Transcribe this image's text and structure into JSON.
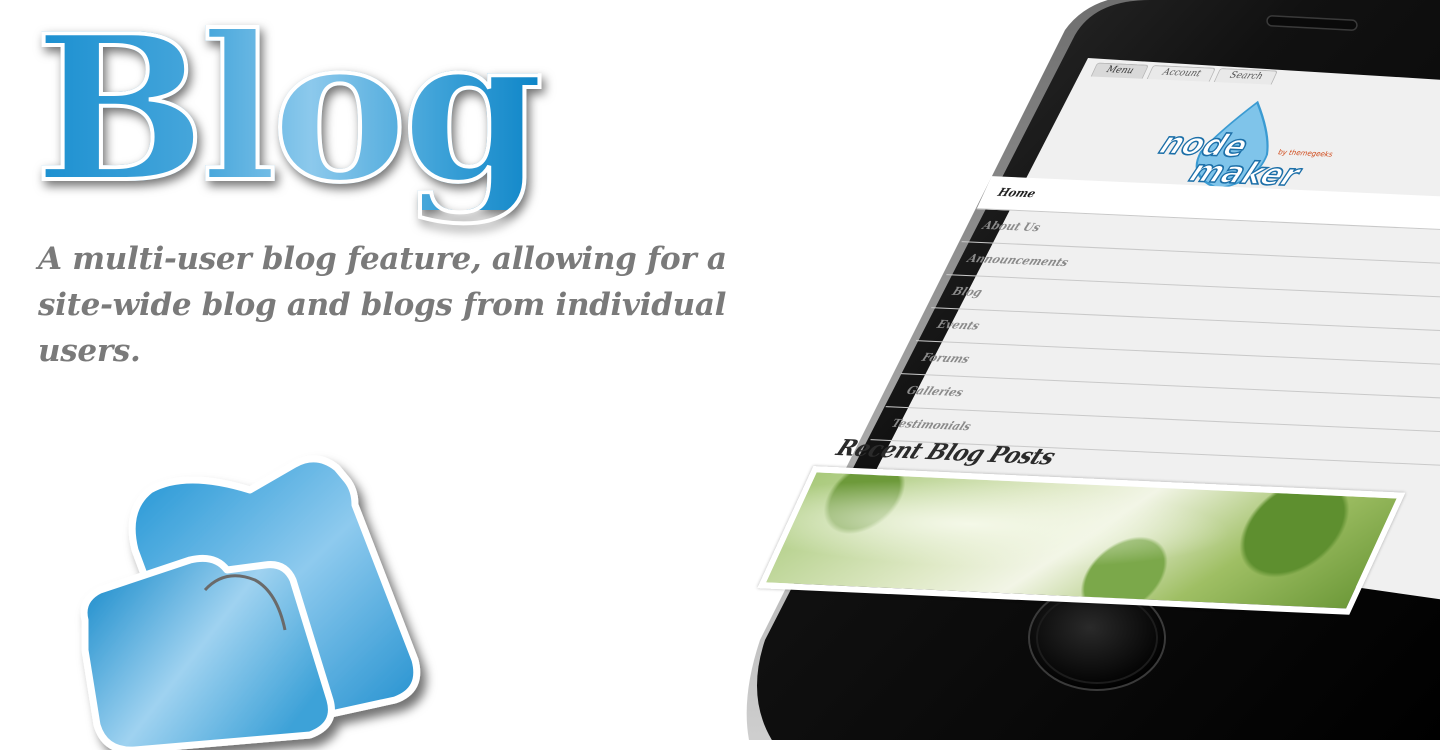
{
  "hero": {
    "title": "Blog",
    "description": "A multi-user blog feature, allowing for a site-wide blog and blogs from individual users."
  },
  "colors": {
    "brand_blue": "#1a8fd0",
    "brand_light_blue": "#8cc9ec",
    "text_gray": "#7a7a7a",
    "phone_black": "#111111"
  },
  "phone": {
    "tabs": [
      {
        "label": "Menu"
      },
      {
        "label": "Account"
      },
      {
        "label": "Search"
      }
    ],
    "logo": {
      "line1": "node",
      "line2": "maker",
      "byline": "by themegeeks"
    },
    "nav": [
      {
        "label": "Home",
        "active": true,
        "has_dropdown": false
      },
      {
        "label": "About Us",
        "active": false,
        "has_dropdown": false
      },
      {
        "label": "Announcements",
        "active": false,
        "has_dropdown": false
      },
      {
        "label": "Blog",
        "active": false,
        "has_dropdown": true
      },
      {
        "label": "Events",
        "active": false,
        "has_dropdown": true
      },
      {
        "label": "Forums",
        "active": false,
        "has_dropdown": true
      },
      {
        "label": "Galleries",
        "active": false,
        "has_dropdown": true
      },
      {
        "label": "Testimonials",
        "active": false,
        "has_dropdown": false
      }
    ],
    "recent_title": "Recent Blog Posts"
  },
  "icons": {
    "blog_logo": "blog-document-icon",
    "dropdown": "caret-down-icon",
    "home_button": "home-button-icon"
  }
}
